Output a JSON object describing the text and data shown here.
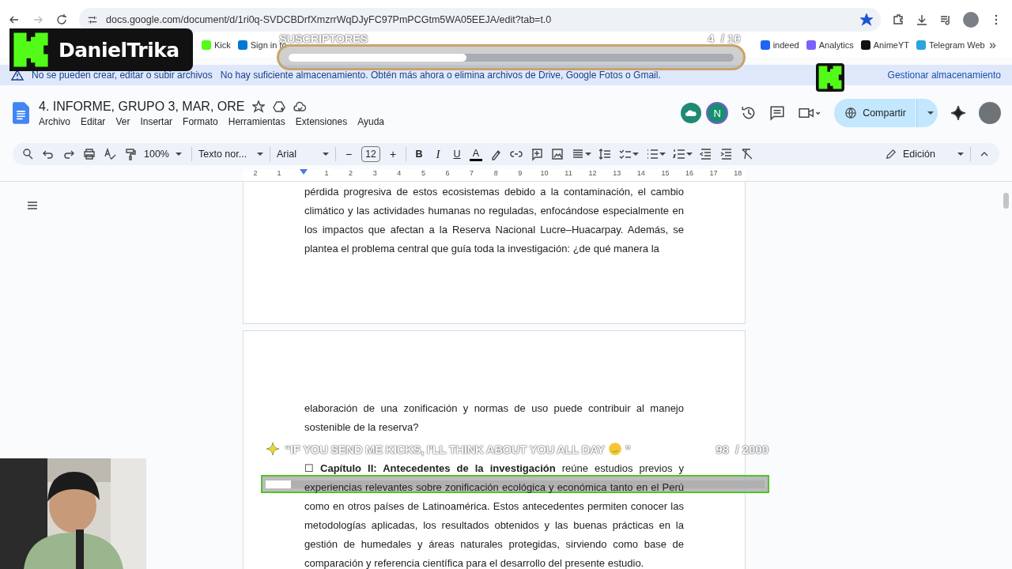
{
  "browser": {
    "url": "docs.google.com/document/d/1ri0q-SVDCBDrfXmzrrWqDJyFC97PmPCGtm5WA05EEJA/edit?tab=t.0",
    "bookmarks": [
      {
        "label": "Kick",
        "color": "#53fc18"
      },
      {
        "label": "Sign in to",
        "color": "#0078d4"
      },
      {
        "label": "indeed",
        "color": "#2164f3"
      },
      {
        "label": "Analytics",
        "color": "#7b61ff"
      },
      {
        "label": "AnimeYT",
        "color": "#111111"
      },
      {
        "label": "Telegram Web",
        "color": "#2aa3df"
      }
    ],
    "more": "»"
  },
  "banner": {
    "title": "No se pueden crear, editar o subir archivos",
    "message": "No hay suficiente almacenamiento. Obtén más ahora o elimina archivos de Drive, Google Fotos o Gmail.",
    "action": "Gestionar almacenamiento"
  },
  "doc": {
    "title": "4. INFORME, GRUPO 3, MAR, ORE",
    "menu": [
      "Archivo",
      "Editar",
      "Ver",
      "Insertar",
      "Formato",
      "Herramientas",
      "Extensiones",
      "Ayuda"
    ],
    "collaborator": "N",
    "share": "Compartir",
    "zoom": "100%",
    "style": "Texto nor...",
    "font": "Arial",
    "minus": "−",
    "size": "12",
    "plus": "+",
    "format": [
      "B",
      "I",
      "U",
      "A"
    ],
    "mode": "Edición",
    "ruler": [
      "2",
      "1",
      "1",
      "2",
      "3",
      "4",
      "5",
      "6",
      "7",
      "8",
      "9",
      "10",
      "11",
      "12",
      "13",
      "14",
      "15",
      "16",
      "17",
      "18"
    ]
  },
  "pages": [
    {
      "paragraphs": [
        "pérdida progresiva de estos ecosistemas debido a la contaminación, el cambio climático y las actividades humanas no reguladas, enfocándose especialmente en los impactos que afectan a la Reserva Nacional Lucre–Huacarpay. Además, se plantea el problema central que guía toda la investigación: ¿de qué manera la"
      ]
    },
    {
      "paragraphs": [
        "elaboración de una zonificación y normas de uso puede contribuir al manejo sostenible de la reserva?",
        "☐ **Capítulo II: Antecedentes de la investigación** reúne estudios previos y experiencias relevantes sobre zonificación ecológica y económica tanto en el Perú como en otros países de Latinoamérica. Estos antecedentes permiten conocer las metodologías aplicadas, los resultados obtenidos y las buenas prácticas en la gestión de humedales y áreas naturales protegidas, sirviendo como base de comparación y referencia científica para el desarrollo del presente estudio."
      ]
    }
  ],
  "overlay": {
    "streamer": "DanielTrika",
    "sub_goal": {
      "label": "SUSCRIPTORES",
      "count": "4",
      "target": "/ 10",
      "level": 0.4
    },
    "kick_goal": {
      "label": "“IF YOU SEND ME KICKS, I'LL THINK ABOUT YOU ALL DAY",
      "quote_end": "”",
      "count": "98",
      "target": "/ 2000",
      "level": 0.05
    }
  }
}
